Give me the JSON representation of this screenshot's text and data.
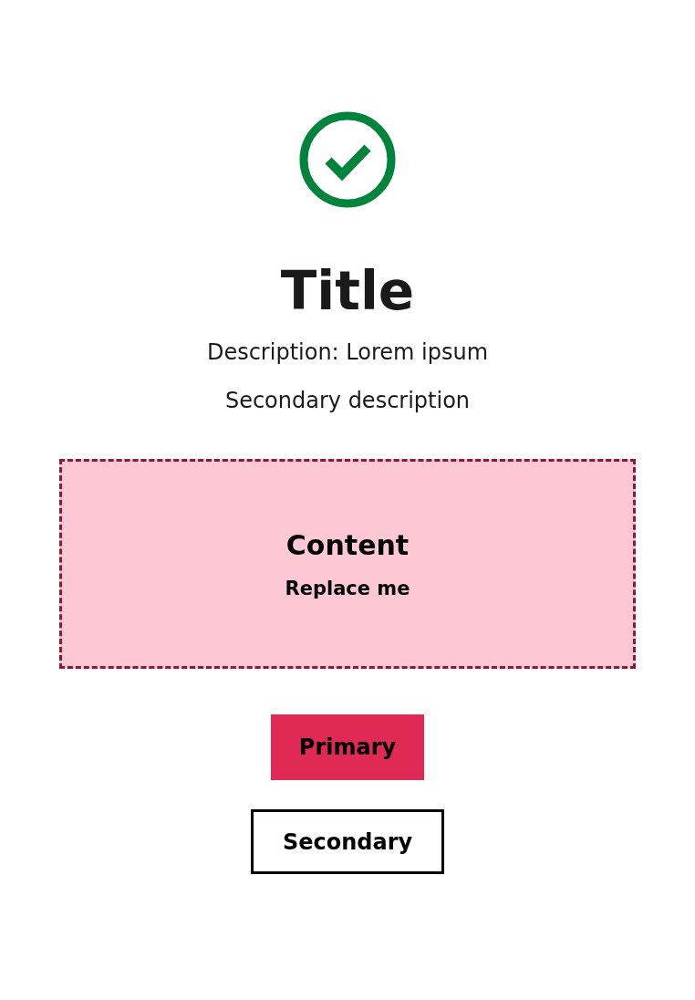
{
  "status": {
    "kind": "success"
  },
  "title": "Title",
  "description": "Description: Lorem ipsum",
  "secondary_description": "Secondary description",
  "content": {
    "heading": "Content",
    "subheading": "Replace me"
  },
  "buttons": [
    {
      "label": "Primary",
      "kind": "primary"
    },
    {
      "label": "Secondary",
      "kind": "secondary"
    }
  ]
}
